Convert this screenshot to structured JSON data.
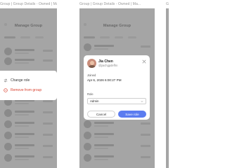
{
  "frames": [
    {
      "title": "Group | Group Details - Owned | Ma..."
    },
    {
      "title": "Group | Group Details - Owned | Ma..."
    },
    {
      "title": "Gr"
    }
  ],
  "screen": {
    "header": "Manage Group"
  },
  "menu": {
    "change_role": "Change role",
    "remove_from_group": "Remove from group"
  },
  "dialog": {
    "name": "Jia Chen",
    "handle": "@jiachgpdefhn",
    "joined_label": "Joined",
    "joined_value": "Apr 6, 2026 6:00:27 PM",
    "role_label": "Role",
    "role_value": "Admin",
    "cancel_label": "Cancel",
    "save_label": "Save role"
  },
  "colors": {
    "overlay": "#a5a5a5",
    "primary": "#5b7cf0",
    "danger": "#d9412f"
  }
}
